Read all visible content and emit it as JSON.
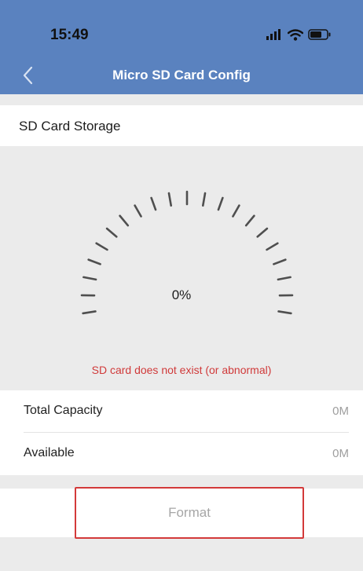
{
  "status_bar": {
    "time": "15:49",
    "icons": [
      "signal-icon",
      "wifi-icon",
      "battery-icon"
    ]
  },
  "nav": {
    "title": "Micro SD Card Config",
    "back_icon": "chevron-left-icon"
  },
  "storage": {
    "section_label": "SD Card Storage",
    "usage_percent": 0,
    "usage_text": "0%",
    "error_text": "SD card does not exist (or abnormal)"
  },
  "details": {
    "total_capacity": {
      "label": "Total Capacity",
      "value": "0M"
    },
    "available": {
      "label": "Available",
      "value": "0M"
    }
  },
  "actions": {
    "format_label": "Format"
  },
  "colors": {
    "header": "#5a82bf",
    "error": "#d03a3a",
    "button_outline": "#d33a3a"
  }
}
